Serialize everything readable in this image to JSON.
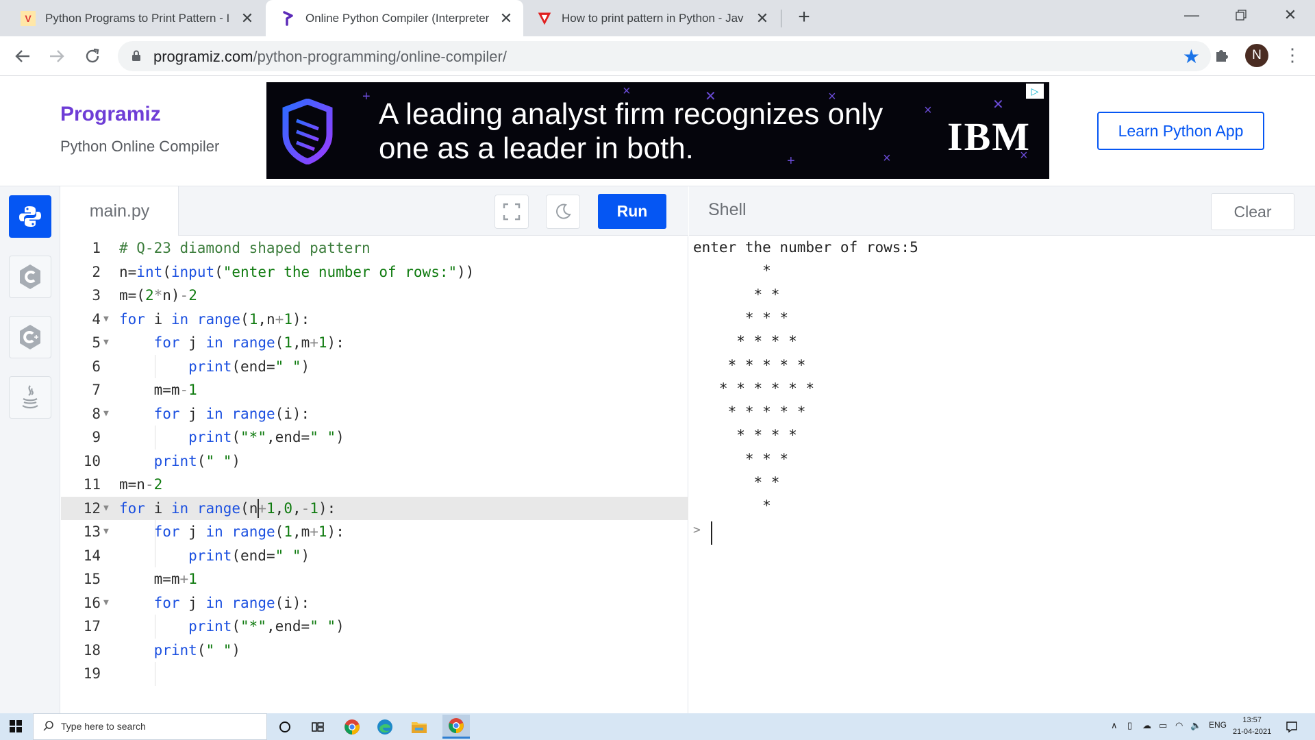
{
  "browser": {
    "tabs": [
      {
        "title": "Python Programs to Print Pattern - I",
        "favicon": "vn-favicon",
        "active": false
      },
      {
        "title": "Online Python Compiler (Interpreter",
        "favicon": "programiz-favicon",
        "active": true
      },
      {
        "title": "How to print pattern in Python - Jav",
        "favicon": "javatpoint-favicon",
        "active": false
      }
    ],
    "url_host": "programiz.com",
    "url_path": "/python-programming/online-compiler/",
    "profile_initial": "N"
  },
  "header": {
    "logo": "Programiz",
    "subtitle": "Python Online Compiler",
    "learn_button": "Learn Python App"
  },
  "ad": {
    "line1": "A leading analyst firm recognizes only",
    "line2": "one as a leader in both.",
    "brand": "IBM"
  },
  "editor": {
    "filename": "main.py",
    "run_label": "Run",
    "lines": [
      "# Q-23 diamond shaped pattern",
      "n=int(input(\"enter the number of rows:\"))",
      "m=(2*n)-2",
      "for i in range(1,n+1):",
      "    for j in range(1,m+1):",
      "        print(end=\" \")",
      "    m=m-1",
      "    for j in range(i):",
      "        print(\"*\",end=\" \")",
      "    print(\" \")",
      "m=n-2",
      "for i in range(n+1,0,-1):",
      "    for j in range(1,m+1):",
      "        print(end=\" \")",
      "    m=m+1",
      "    for j in range(i):",
      "        print(\"*\",end=\" \")",
      "    print(\" \")",
      ""
    ],
    "folded_lines": [
      4,
      5,
      8,
      12,
      13,
      16
    ],
    "highlighted_line": 12
  },
  "shell": {
    "title": "Shell",
    "clear_label": "Clear",
    "prompt": ">",
    "output": [
      "enter the number of rows:5",
      "        *",
      "       * *",
      "      * * *",
      "     * * * *",
      "    * * * * *",
      "   * * * * * *",
      "    * * * * *",
      "     * * * *",
      "      * * *",
      "       * *",
      "        *"
    ]
  },
  "taskbar": {
    "search_placeholder": "Type here to search",
    "language": "ENG",
    "time": "13:57",
    "date": "21-04-2021"
  },
  "colors": {
    "accent": "#0556f3",
    "keyword": "#1a4fe0",
    "string": "#0e7a0e",
    "number": "#0e7a0e",
    "comment": "#3c7d3c",
    "logo": "#6e3dd6"
  }
}
